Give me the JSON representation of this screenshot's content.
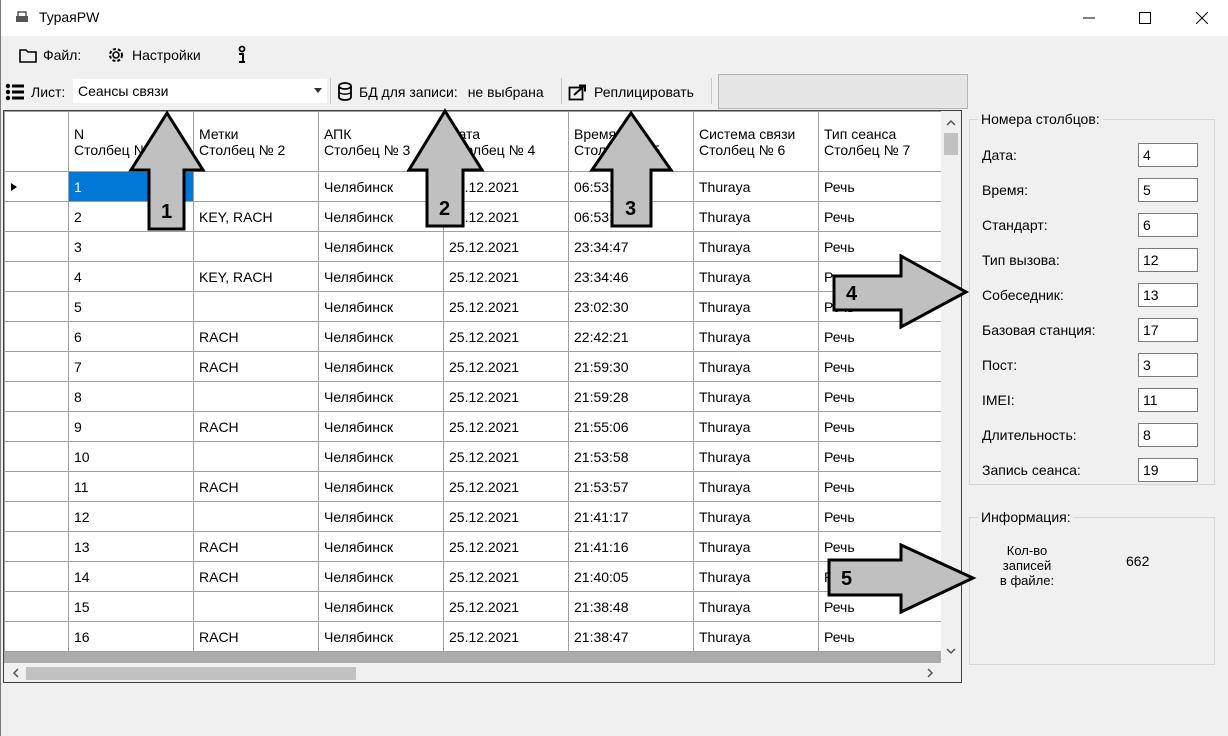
{
  "window": {
    "title": "ТураяPW",
    "minimize": "—",
    "maximize": "☐",
    "close": "✕"
  },
  "menu": {
    "file": "Файл:",
    "settings": "Настройки"
  },
  "toolbar": {
    "sheet_label": "Лист:",
    "sheet_value": "Сеансы связи",
    "db_label": "БД для записи:",
    "db_value": "не выбрана",
    "replicate": "Реплицировать"
  },
  "grid": {
    "columns": [
      {
        "line1": "N",
        "line2": "Столбец № 1"
      },
      {
        "line1": "Метки",
        "line2": "Столбец № 2"
      },
      {
        "line1": "АПК",
        "line2": "Столбец № 3"
      },
      {
        "line1": "Дата",
        "line2": "Столбец № 4"
      },
      {
        "line1": "Время",
        "line2": "Столбец № 5"
      },
      {
        "line1": "Система связи",
        "line2": "Столбец № 6"
      },
      {
        "line1": "Тип сеанса",
        "line2": "Столбец № 7"
      }
    ],
    "rows": [
      [
        "1",
        "",
        "Челябинск",
        "25.12.2021",
        "06:53:55",
        "Thuraya",
        "Речь"
      ],
      [
        "2",
        "KEY, RACH",
        "Челябинск",
        "25.12.2021",
        "06:53:54",
        "Thuraya",
        "Речь"
      ],
      [
        "3",
        "",
        "Челябинск",
        "25.12.2021",
        "23:34:47",
        "Thuraya",
        "Речь"
      ],
      [
        "4",
        "KEY, RACH",
        "Челябинск",
        "25.12.2021",
        "23:34:46",
        "Thuraya",
        "Речь"
      ],
      [
        "5",
        "",
        "Челябинск",
        "25.12.2021",
        "23:02:30",
        "Thuraya",
        "Речь"
      ],
      [
        "6",
        "RACH",
        "Челябинск",
        "25.12.2021",
        "22:42:21",
        "Thuraya",
        "Речь"
      ],
      [
        "7",
        "RACH",
        "Челябинск",
        "25.12.2021",
        "21:59:30",
        "Thuraya",
        "Речь"
      ],
      [
        "8",
        "",
        "Челябинск",
        "25.12.2021",
        "21:59:28",
        "Thuraya",
        "Речь"
      ],
      [
        "9",
        "RACH",
        "Челябинск",
        "25.12.2021",
        "21:55:06",
        "Thuraya",
        "Речь"
      ],
      [
        "10",
        "",
        "Челябинск",
        "25.12.2021",
        "21:53:58",
        "Thuraya",
        "Речь"
      ],
      [
        "11",
        "RACH",
        "Челябинск",
        "25.12.2021",
        "21:53:57",
        "Thuraya",
        "Речь"
      ],
      [
        "12",
        "",
        "Челябинск",
        "25.12.2021",
        "21:41:17",
        "Thuraya",
        "Речь"
      ],
      [
        "13",
        "RACH",
        "Челябинск",
        "25.12.2021",
        "21:41:16",
        "Thuraya",
        "Речь"
      ],
      [
        "14",
        "RACH",
        "Челябинск",
        "25.12.2021",
        "21:40:05",
        "Thuraya",
        "Речь"
      ],
      [
        "15",
        "",
        "Челябинск",
        "25.12.2021",
        "21:38:48",
        "Thuraya",
        "Речь"
      ],
      [
        "16",
        "RACH",
        "Челябинск",
        "25.12.2021",
        "21:38:47",
        "Thuraya",
        "Речь"
      ]
    ]
  },
  "columns_panel": {
    "title": "Номера столбцов:",
    "fields": [
      {
        "label": "Дата:",
        "value": "4"
      },
      {
        "label": "Время:",
        "value": "5"
      },
      {
        "label": "Стандарт:",
        "value": "6"
      },
      {
        "label": "Тип вызова:",
        "value": "12"
      },
      {
        "label": "Собеседник:",
        "value": "13"
      },
      {
        "label": "Базовая станция:",
        "value": "17"
      },
      {
        "label": "Пост:",
        "value": "3"
      },
      {
        "label": "IMEI:",
        "value": "11"
      },
      {
        "label": "Длительность:",
        "value": "8"
      },
      {
        "label": "Запись сеанса:",
        "value": "19"
      }
    ]
  },
  "info_panel": {
    "title": "Информация:",
    "records_label_line1": "Кол-во записей",
    "records_label_line2": "в файле:",
    "records_value": "662"
  },
  "annotations": {
    "arrow1": "1",
    "arrow2": "2",
    "arrow3": "3",
    "arrow4": "4",
    "arrow5": "5",
    "color": "#c0c0c0"
  }
}
